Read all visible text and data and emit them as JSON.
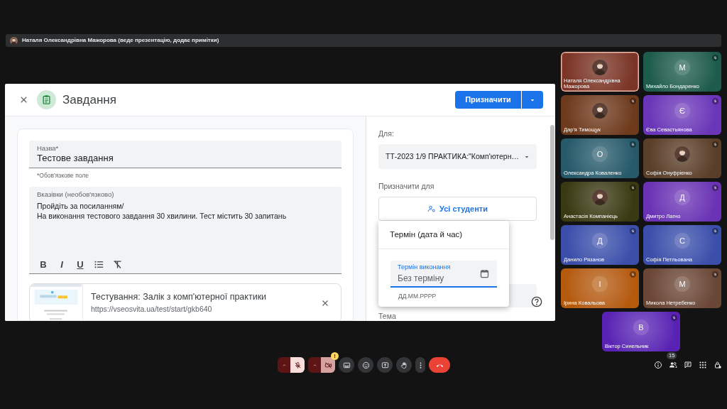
{
  "presenter_bar": {
    "text": "Наталя Олександрівна Мажорова (веде презентацію, додає примітки)"
  },
  "dialog": {
    "title": "Завдання",
    "primary_button": "Призначити",
    "title_field": {
      "label": "Назва*",
      "value": "Тестове завдання",
      "helper": "*Обов'язкове поле"
    },
    "instructions_field": {
      "label": "Вказівки (необов'язково)",
      "lines": [
        "Пройдіть за посиланням/",
        "На виконання тестового завдання 30 хвилини. Тест містить 30 запитань"
      ]
    },
    "format_tools": [
      {
        "kind": "bold",
        "label": "B"
      },
      {
        "kind": "italic",
        "label": "I"
      },
      {
        "kind": "underline",
        "label": "U"
      },
      {
        "kind": "list"
      },
      {
        "kind": "clear"
      }
    ],
    "attachment": {
      "title": "Тестування: Залік з комп'ютерної практики",
      "url": "https://vseosvita.ua/test/start/gkb640"
    },
    "for_label": "Для:",
    "class_select": "ТТ-2023 1/9 ПРАКТИКА:\"Комп'ютерн…",
    "assign_label": "Призначити для",
    "students_button": "Усі студенти",
    "due_popup": {
      "title": "Термін (дата й час)",
      "field_label": "Термін виконання",
      "value": "Без терміну",
      "helper": "ДД.ММ.РРРР"
    },
    "topic_label": "Тема"
  },
  "tiles": [
    {
      "name": "Наталя Олександрівна Мажорова",
      "color": "#7a3526",
      "muted": false,
      "speaking": true
    },
    {
      "name": "Михайло Бондаренко",
      "kind": "initial",
      "initial": "М",
      "color": "#1d5c4c",
      "muted": true,
      "speaking": false
    },
    {
      "name": "Дар'я Тимощук",
      "color": "#6e3a1c",
      "muted": true,
      "speaking": false
    },
    {
      "name": "Єва Севастьянова",
      "kind": "initial",
      "initial": "Є",
      "color": "#6a35b8",
      "muted": true,
      "speaking": false
    },
    {
      "name": "Олександра Коваленко",
      "kind": "initial",
      "initial": "О",
      "color": "#265a6a",
      "muted": true,
      "speaking": false
    },
    {
      "name": "Софія Онуфрієнко",
      "color": "#5a3e28",
      "muted": true,
      "speaking": false
    },
    {
      "name": "Анастасія Компанієць",
      "color": "#3a3a12",
      "muted": true,
      "speaking": false
    },
    {
      "name": "Дмитро Лагно",
      "kind": "initial",
      "initial": "Д",
      "color": "#6a32b4",
      "muted": true,
      "speaking": false
    },
    {
      "name": "Данило Рязанов",
      "kind": "initial",
      "initial": "Д",
      "color": "#3a4eaa",
      "muted": true,
      "speaking": false
    },
    {
      "name": "Софія Петльована",
      "kind": "initial",
      "initial": "С",
      "color": "#3a4eaa",
      "muted": true,
      "speaking": false
    },
    {
      "name": "Ірина Ковальова",
      "kind": "initial",
      "initial": "І",
      "color": "#b45a0c",
      "muted": true,
      "speaking": false
    },
    {
      "name": "Микола Нетребенко",
      "kind": "initial",
      "initial": "М",
      "color": "#6a4636",
      "muted": true,
      "speaking": false
    },
    {
      "name": "Віктор Синельник",
      "kind": "initial",
      "initial": "В",
      "color": "#5a22b4",
      "muted": true,
      "speaking": false
    }
  ],
  "toolbar": {
    "controls": [
      {
        "kind": "mic",
        "on": false
      },
      {
        "kind": "camera",
        "on": false,
        "badge": "!"
      },
      {
        "kind": "captions"
      },
      {
        "kind": "emoji"
      },
      {
        "kind": "present"
      },
      {
        "kind": "hand"
      },
      {
        "kind": "more"
      },
      {
        "kind": "end"
      }
    ],
    "side": [
      {
        "kind": "info"
      },
      {
        "kind": "people",
        "badge": "15"
      },
      {
        "kind": "chat"
      },
      {
        "kind": "activities"
      },
      {
        "kind": "host"
      }
    ]
  }
}
